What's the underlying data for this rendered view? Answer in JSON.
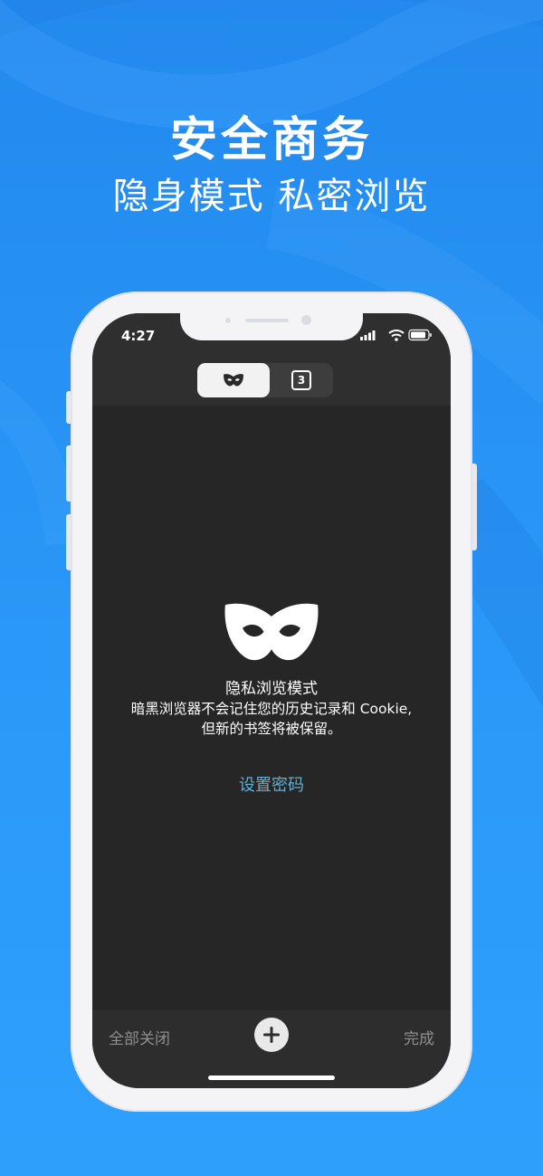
{
  "marketing": {
    "headline": "安全商务",
    "subline": "隐身模式 私密浏览"
  },
  "status_bar": {
    "time": "4:27",
    "icons": [
      "signal-icon",
      "wifi-icon",
      "battery-icon"
    ]
  },
  "tab_switcher": {
    "private_icon": "mask-icon",
    "tab_count": "3",
    "selected": "private"
  },
  "private_mode": {
    "icon": "mask-icon",
    "title": "隐私浏览模式",
    "description_line1": "暗黑浏览器不会记住您的历史记录和 Cookie,",
    "description_line2": "但新的书签将被保留。",
    "set_password_link": "设置密码"
  },
  "bottom_bar": {
    "close_all_label": "全部关闭",
    "add_icon": "plus-icon",
    "done_label": "完成"
  },
  "colors": {
    "background_blue": "#2a98f8",
    "screen_dark": "#262626",
    "link_color": "#5fb1d6"
  }
}
